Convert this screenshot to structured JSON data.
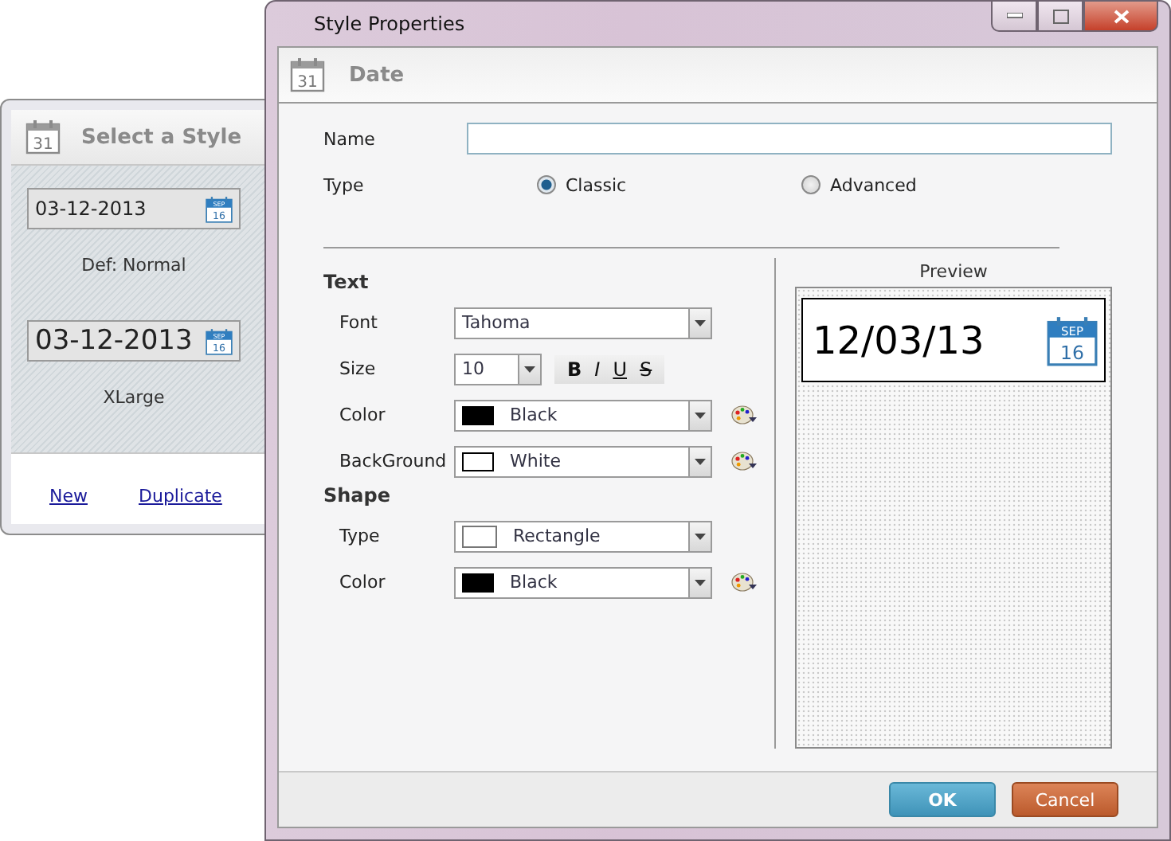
{
  "style_list_window": {
    "header": {
      "title": "Select a Style",
      "icon_day": "31"
    },
    "styles": [
      {
        "value": "03-12-2013",
        "kind": "normal",
        "label": "Def: Normal",
        "icon_month": "SEP",
        "icon_day": "16"
      },
      {
        "value": "03-12-2013",
        "kind": "xlarge",
        "label": "XLarge",
        "icon_month": "SEP",
        "icon_day": "16"
      }
    ],
    "links": [
      "New",
      "Duplicate"
    ]
  },
  "dialog": {
    "title": "Style Properties",
    "header": {
      "title": "Date",
      "icon_day": "31"
    },
    "name": {
      "label": "Name"
    },
    "type": {
      "label": "Type",
      "options": [
        {
          "label": "Classic",
          "selected": true
        },
        {
          "label": "Advanced",
          "selected": false
        }
      ]
    },
    "text_section": {
      "title": "Text",
      "font": {
        "label": "Font",
        "value": "Tahoma"
      },
      "size": {
        "label": "Size",
        "value": "10"
      },
      "format_buttons": [
        {
          "label": "B",
          "kind": "bold"
        },
        {
          "label": "I",
          "kind": "italic"
        },
        {
          "label": "U",
          "kind": "underline"
        },
        {
          "label": "S",
          "kind": "strike"
        }
      ],
      "color": {
        "label": "Color",
        "value": "Black",
        "color": "#000000"
      },
      "background": {
        "label": "BackGround",
        "value": "White",
        "color": "#ffffff"
      }
    },
    "shape_section": {
      "title": "Shape",
      "type": {
        "label": "Type",
        "value": "Rectangle"
      },
      "color": {
        "label": "Color",
        "value": "Black",
        "color": "#000000"
      }
    },
    "preview": {
      "label": "Preview",
      "date": "12/03/13",
      "icon_month": "SEP",
      "icon_day": "16"
    },
    "buttons": [
      {
        "label": "OK",
        "kind": "primary"
      },
      {
        "label": "Cancel",
        "kind": "cancel"
      }
    ]
  }
}
